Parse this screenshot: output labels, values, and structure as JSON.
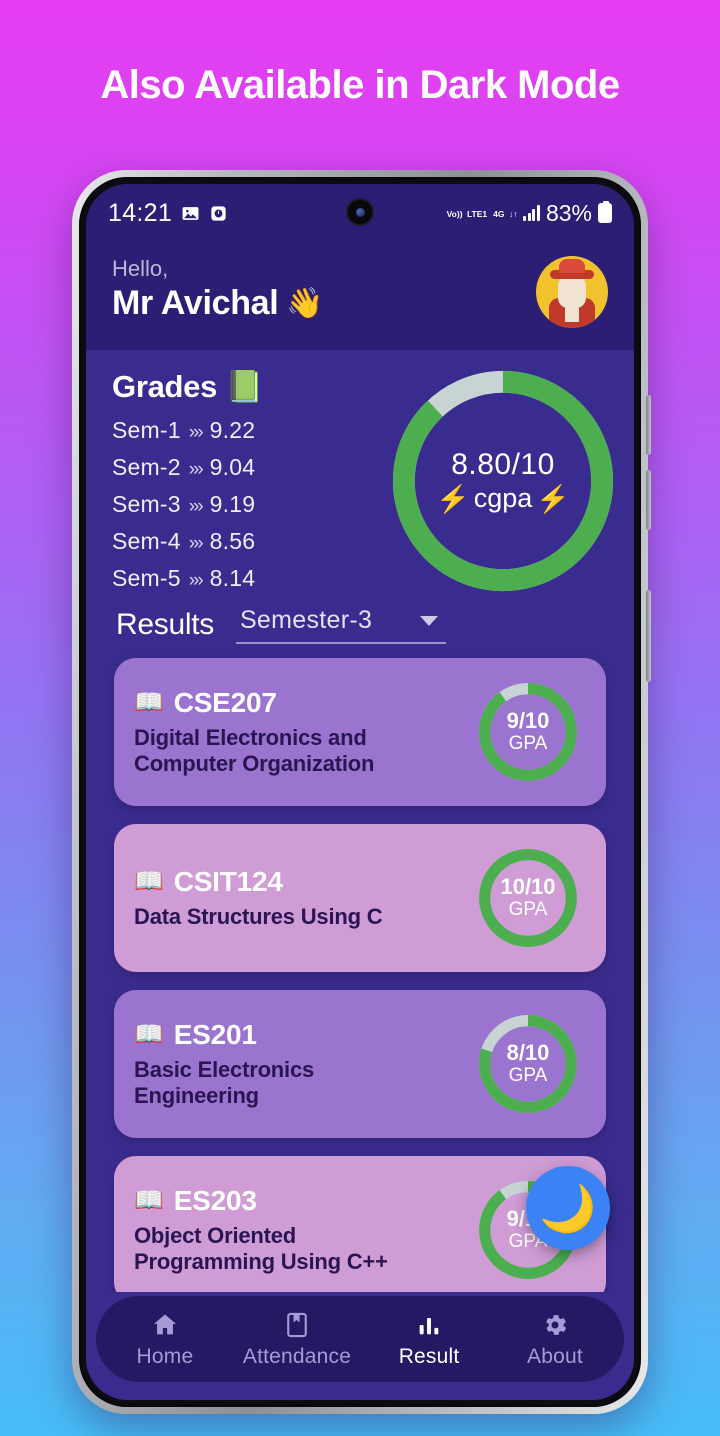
{
  "banner": {
    "title": "Also Available in Dark Mode"
  },
  "status_bar": {
    "time": "14:21",
    "icons": [
      "image-icon",
      "clock-icon"
    ],
    "volte": "Vo))",
    "volte_sub": "LTE1",
    "network": "4G",
    "battery_percent": "83%",
    "signal_bars": 4
  },
  "header": {
    "greeting": "Hello,",
    "username": "Mr Avichal",
    "wave_emoji": "👋",
    "avatar": "user-avatar"
  },
  "grades": {
    "title": "Grades",
    "book_emoji": "📗",
    "arrow": "⋙",
    "semesters": [
      {
        "label": "Sem-1",
        "value": "9.22"
      },
      {
        "label": "Sem-2",
        "value": "9.04"
      },
      {
        "label": "Sem-3",
        "value": "9.19"
      },
      {
        "label": "Sem-4",
        "value": "8.56"
      },
      {
        "label": "Sem-5",
        "value": "8.14"
      }
    ]
  },
  "cgpa": {
    "value": "8.80/10",
    "label": "cgpa",
    "bolt_emoji": "⚡",
    "percent": 88,
    "ring_color": "#4cae4f",
    "track_color": "#c8d4d4"
  },
  "results": {
    "title": "Results",
    "dropdown_value": "Semester-3",
    "dropdown_icon": "chevron-down-icon"
  },
  "courses": [
    {
      "code": "CSE207",
      "name": "Digital Electronics and\nComputer Organization",
      "gpa": "9/10",
      "gpa_label": "GPA",
      "percent": 90,
      "book_emoji": "📖"
    },
    {
      "code": "CSIT124",
      "name": "Data Structures Using C",
      "gpa": "10/10",
      "gpa_label": "GPA",
      "percent": 100,
      "book_emoji": "📖"
    },
    {
      "code": "ES201",
      "name": "Basic Electronics\nEngineering",
      "gpa": "8/10",
      "gpa_label": "GPA",
      "percent": 80,
      "book_emoji": "📖"
    },
    {
      "code": "ES203",
      "name": "Object Oriented\nProgramming Using C++",
      "gpa": "9/10",
      "gpa_label": "GPA",
      "percent": 90,
      "book_emoji": "📖"
    }
  ],
  "fab": {
    "icon": "moon-icon",
    "glyph": "🌙",
    "color": "#3b82f6"
  },
  "bottom_nav": {
    "items": [
      {
        "label": "Home",
        "icon": "home-icon",
        "active": false
      },
      {
        "label": "Attendance",
        "icon": "bookmark-icon",
        "active": false
      },
      {
        "label": "Result",
        "icon": "bar-chart-icon",
        "active": true
      },
      {
        "label": "About",
        "icon": "gear-icon",
        "active": false
      }
    ]
  },
  "colors": {
    "app_bg": "#3a2c8f",
    "header_bg": "#2b1e74",
    "nav_bg": "#241a63",
    "card_odd": "#9b74cf",
    "card_even": "#cf9cd6",
    "accent_green": "#4cae4f",
    "accent_blue": "#3b82f6"
  }
}
